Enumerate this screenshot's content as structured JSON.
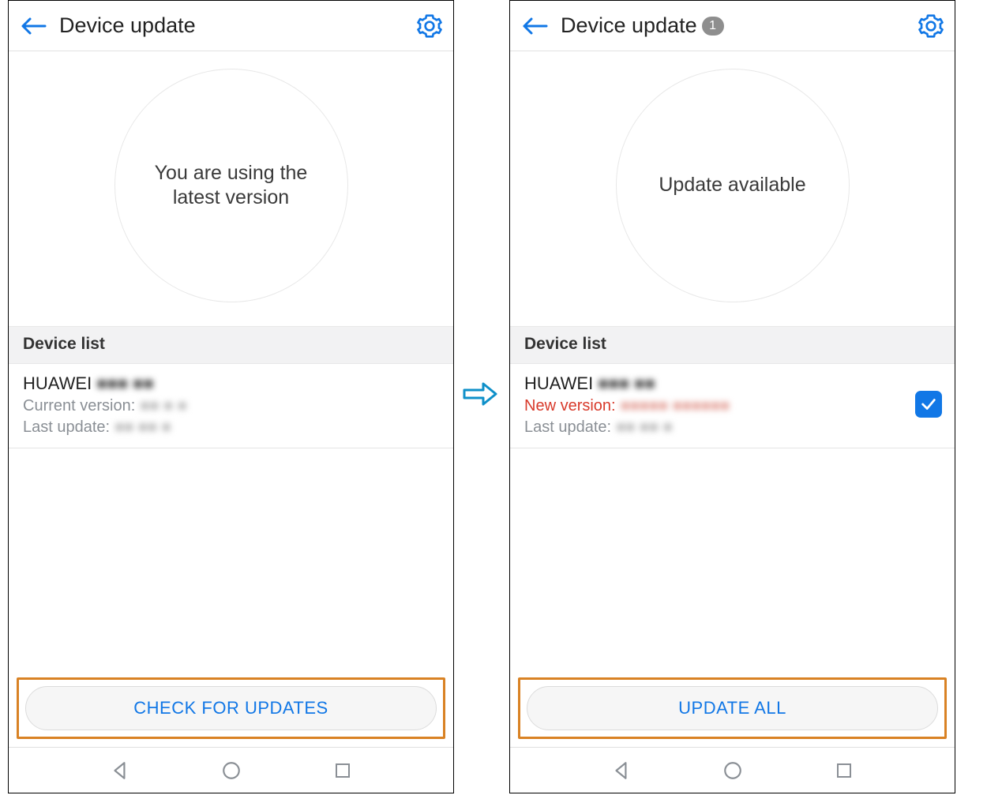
{
  "colors": {
    "accent": "#1177e6",
    "highlight": "#d98224",
    "muted": "#8a8f95",
    "error": "#d83a2b"
  },
  "screens": {
    "left": {
      "header": {
        "title": "Device update",
        "badge": null
      },
      "status": {
        "message": "You are using the latest version"
      },
      "device_list": {
        "heading": "Device list",
        "items": [
          {
            "name": "HUAWEI",
            "name_suffix_redacted": "■■■ ■■",
            "rows": [
              {
                "label": "Current version:",
                "value_redacted": "■■ ■ ■",
                "emphasis": "normal"
              },
              {
                "label": "Last update:",
                "value_redacted": "■■ ■■ ■",
                "emphasis": "normal"
              }
            ],
            "selected": false
          }
        ]
      },
      "action": {
        "label": "CHECK FOR UPDATES"
      }
    },
    "right": {
      "header": {
        "title": "Device update",
        "badge": "1"
      },
      "status": {
        "message": "Update available"
      },
      "device_list": {
        "heading": "Device list",
        "items": [
          {
            "name": "HUAWEI",
            "name_suffix_redacted": "■■■ ■■",
            "rows": [
              {
                "label": "New version:",
                "value_redacted": "■■■■■  ■■■■■■",
                "emphasis": "red"
              },
              {
                "label": "Last update:",
                "value_redacted": "■■ ■■ ■",
                "emphasis": "normal"
              }
            ],
            "selected": true
          }
        ]
      },
      "action": {
        "label": "UPDATE ALL"
      }
    }
  }
}
